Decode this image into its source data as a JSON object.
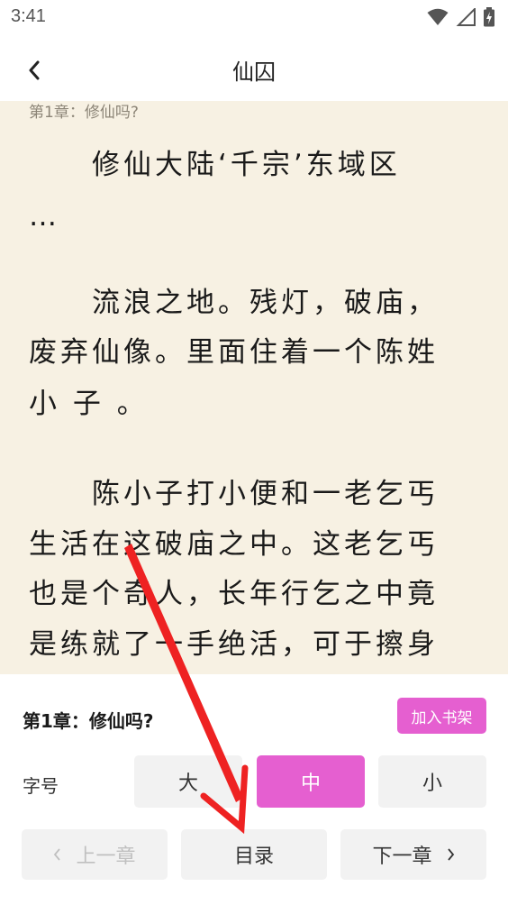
{
  "status_bar": {
    "time": "3:41"
  },
  "header": {
    "back_icon": "chevron-left-icon",
    "title": "仙囚"
  },
  "reader": {
    "chapter_label": "第1章：修仙吗?",
    "lines": [
      "　　修仙大陆‘千宗’东域区",
      "…",
      "　　流浪之地。残灯，破庙，",
      "废弃仙像。里面住着一个陈姓",
      "小 子 。",
      "　　陈小子打小便和一老乞丐",
      "生活在这破庙之中。这老乞丐",
      "也是个奇人，长年行乞之中竟",
      "是练就了一手绝活，可于擦身"
    ]
  },
  "panel": {
    "chapter_title": "第1章：修仙吗?",
    "add_bookshelf": "加入书架",
    "font_size_label": "字号",
    "size_large": "大",
    "size_medium": "中",
    "size_small": "小",
    "prev_chapter": "上一章",
    "toc": "目录",
    "next_chapter": "下一章"
  },
  "colors": {
    "accent": "#e55fd0",
    "reader_bg": "#f7f1e3",
    "annotation_arrow": "#ee2222"
  }
}
